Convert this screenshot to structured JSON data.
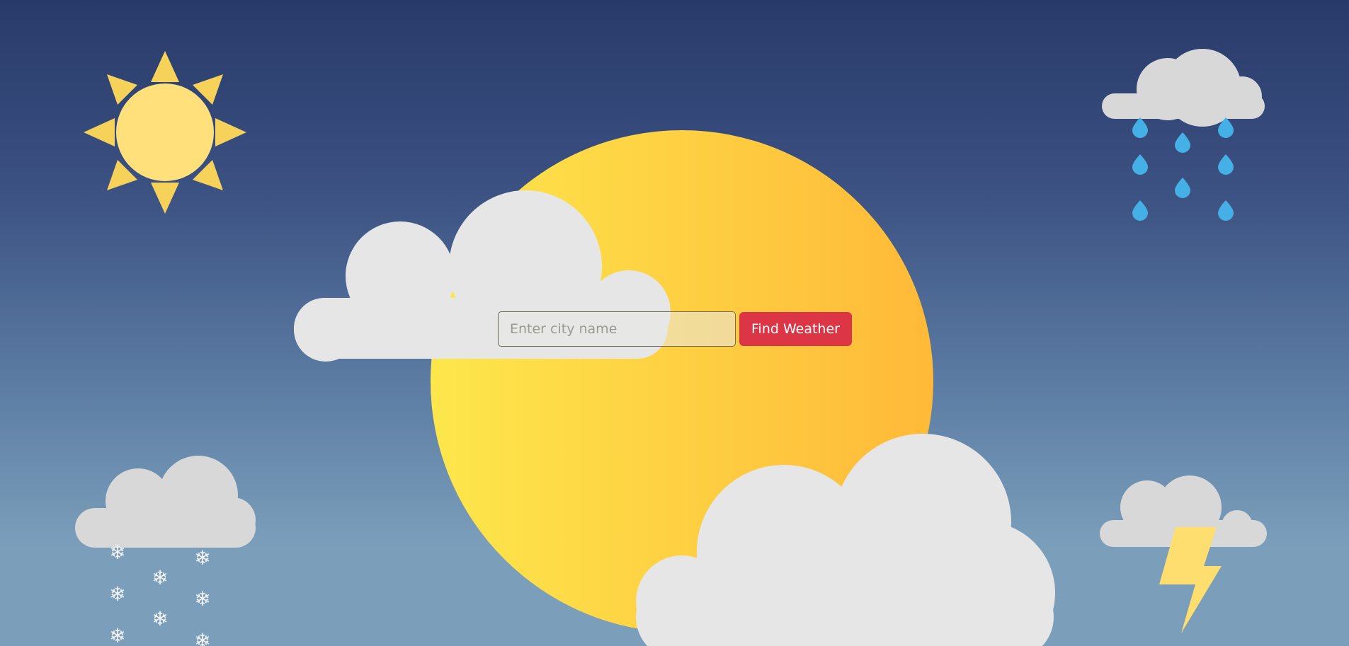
{
  "search": {
    "placeholder": "Enter city name",
    "value": "",
    "button_label": "Find Weather"
  },
  "icons": [
    "sun-icon",
    "rain-cloud-icon",
    "snow-cloud-icon",
    "thunder-cloud-icon",
    "big-sun-icon",
    "cloud-icon"
  ],
  "colors": {
    "sky_top": "#283a6a",
    "sky_bottom": "#7b9fbb",
    "sun": "#ffe07a",
    "big_sun_left": "#fde74c",
    "big_sun_right": "#ffb938",
    "cloud": "#e6e6e6",
    "raindrop": "#45b0e6",
    "button": "#dc3545"
  }
}
